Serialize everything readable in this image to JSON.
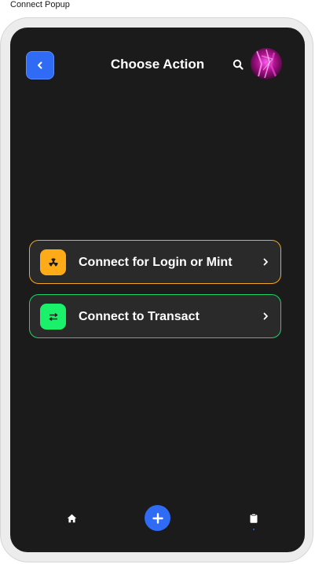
{
  "frame": {
    "caption": "Connect Popup"
  },
  "header": {
    "title": "Choose Action",
    "back_icon": "chevron-left-icon",
    "search_icon": "search-icon",
    "avatar": "user-avatar"
  },
  "actions": [
    {
      "label": "Connect for Login or Mint",
      "icon": "radiation-icon",
      "accent": "#f0a826",
      "icon_bg": "#ffab17"
    },
    {
      "label": "Connect to Transact",
      "icon": "swap-arrows-icon",
      "accent": "#1ed468",
      "icon_bg": "#1af06a"
    }
  ],
  "bottom_nav": {
    "items": [
      {
        "icon": "home-icon"
      },
      {
        "icon": "plus-icon"
      },
      {
        "icon": "clipboard-icon"
      }
    ],
    "active_indicator_color": "#2f6bf5"
  },
  "colors": {
    "screen_bg": "#1b1b1b",
    "card_bg": "#2a2a2a",
    "primary": "#2f6bf5"
  }
}
